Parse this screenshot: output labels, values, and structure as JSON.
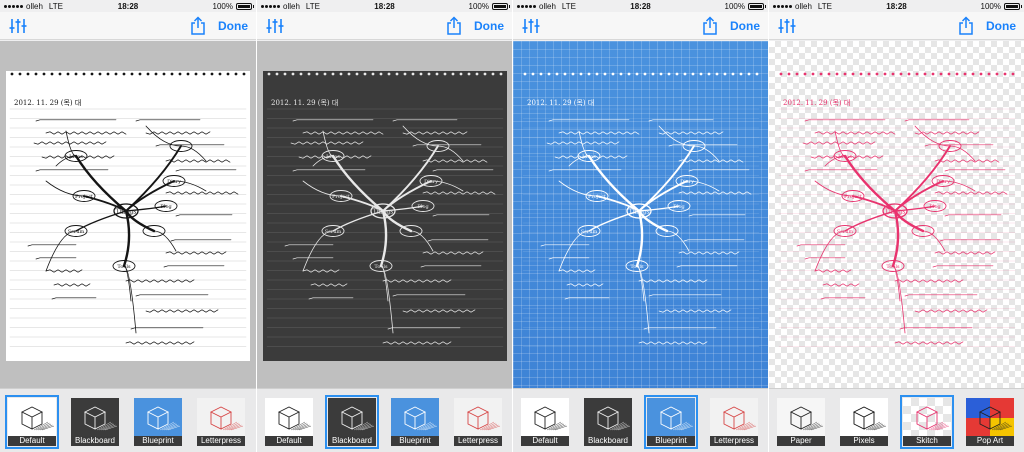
{
  "status": {
    "carrier": "olleh",
    "network": "LTE",
    "time": "18:28",
    "battery": "100%"
  },
  "nav": {
    "done_label": "Done",
    "adjust_icon": "sliders-icon",
    "share_icon": "share-icon"
  },
  "note": {
    "date": "2012. 11. 29 (목) 대",
    "center": "Things",
    "nodes": [
      "Ideas",
      "Project",
      "Scrum",
      "Tools",
      "Diary",
      "Blog"
    ]
  },
  "colors": {
    "accent": "#1a82fb",
    "selected_outline": "#2c90f0",
    "blackboard": "#3b3b3b",
    "blueprint": "#4a92de",
    "skitch_ink": "#e8336e"
  },
  "panels": [
    {
      "name": "default",
      "filters": [
        {
          "label": "Default",
          "selected": true
        },
        {
          "label": "Blackboard",
          "selected": false
        },
        {
          "label": "Blueprint",
          "selected": false
        },
        {
          "label": "Letterpress",
          "selected": false
        }
      ]
    },
    {
      "name": "blackboard",
      "filters": [
        {
          "label": "Default",
          "selected": false
        },
        {
          "label": "Blackboard",
          "selected": true
        },
        {
          "label": "Blueprint",
          "selected": false
        },
        {
          "label": "Letterpress",
          "selected": false
        }
      ]
    },
    {
      "name": "blueprint",
      "filters": [
        {
          "label": "Default",
          "selected": false
        },
        {
          "label": "Blackboard",
          "selected": false
        },
        {
          "label": "Blueprint",
          "selected": true
        },
        {
          "label": "Letterpress",
          "selected": false
        }
      ]
    },
    {
      "name": "skitch",
      "filters": [
        {
          "label": "Paper",
          "selected": false
        },
        {
          "label": "Pixels",
          "selected": false
        },
        {
          "label": "Skitch",
          "selected": true
        },
        {
          "label": "Pop Art",
          "selected": false
        }
      ]
    }
  ]
}
